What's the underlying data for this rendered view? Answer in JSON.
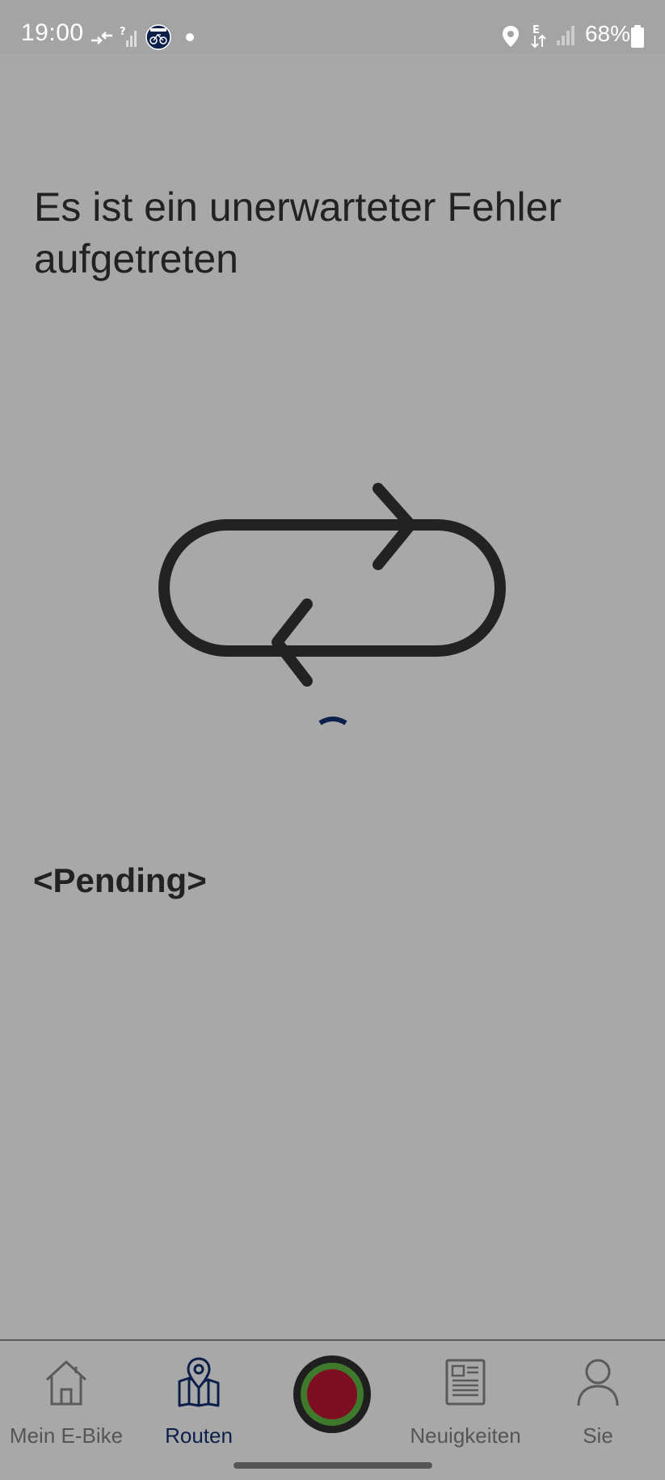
{
  "status_bar": {
    "time": "19:00",
    "battery_pct": "68%",
    "network_badge": "E",
    "signal_unknown_badge": "?"
  },
  "error": {
    "title": "Es ist ein unerwarteter Fehler aufgetreten"
  },
  "status_text": "<Pending>",
  "icons": {
    "illustration": "sync-loop-arrows",
    "spinner": "loading-spinner"
  },
  "colors": {
    "background": "#a8a8a8",
    "accent": "#0b1f4a",
    "record_outer": "#1f1f1f",
    "record_ring": "#3f7a2c",
    "record_core": "#7e0f22"
  },
  "bottom_nav": {
    "active": "Routen",
    "items": [
      {
        "label": "Mein E-Bike",
        "icon": "home-icon"
      },
      {
        "label": "Routen",
        "icon": "map-pin-icon"
      },
      {
        "label": "Neuigkeiten",
        "icon": "news-icon"
      },
      {
        "label": "Sie",
        "icon": "person-icon"
      }
    ],
    "center_button": "record-button"
  }
}
